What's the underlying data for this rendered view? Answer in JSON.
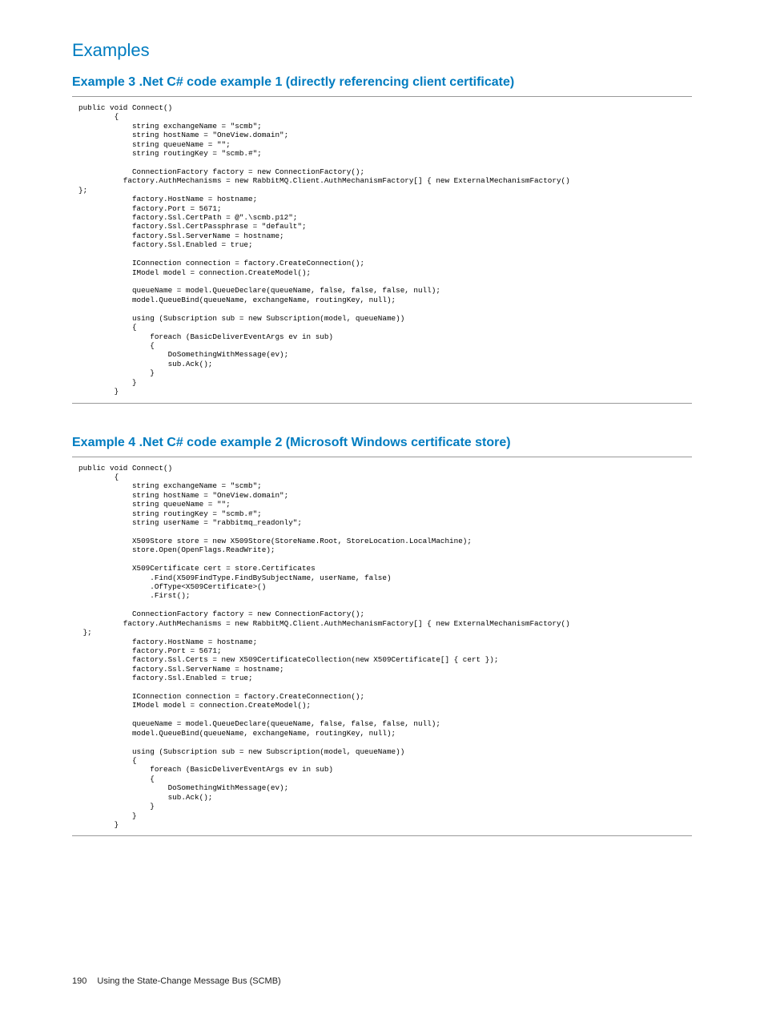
{
  "section": {
    "title": "Examples"
  },
  "example3": {
    "title": "Example 3 .Net C# code example 1 (directly referencing client certificate)",
    "code": "public void Connect()\n        {\n            string exchangeName = \"scmb\";\n            string hostName = \"OneView.domain\";\n            string queueName = \"\";\n            string routingKey = \"scmb.#\";\n\n            ConnectionFactory factory = new ConnectionFactory();\n          factory.AuthMechanisms = new RabbitMQ.Client.AuthMechanismFactory[] { new ExternalMechanismFactory()\n};\n            factory.HostName = hostname;\n            factory.Port = 5671;\n            factory.Ssl.CertPath = @\".\\scmb.p12\";\n            factory.Ssl.CertPassphrase = \"default\";\n            factory.Ssl.ServerName = hostname;\n            factory.Ssl.Enabled = true;\n\n            IConnection connection = factory.CreateConnection();\n            IModel model = connection.CreateModel();\n\n            queueName = model.QueueDeclare(queueName, false, false, false, null);\n            model.QueueBind(queueName, exchangeName, routingKey, null);\n\n            using (Subscription sub = new Subscription(model, queueName))\n            {\n                foreach (BasicDeliverEventArgs ev in sub)\n                {\n                    DoSomethingWithMessage(ev);\n                    sub.Ack();\n                }\n            }\n        }"
  },
  "example4": {
    "title": "Example 4 .Net C# code example 2 (Microsoft Windows certificate store)",
    "code": "public void Connect()\n        {\n            string exchangeName = \"scmb\";\n            string hostName = \"OneView.domain\";\n            string queueName = \"\";\n            string routingKey = \"scmb.#\";\n            string userName = \"rabbitmq_readonly\";\n\n            X509Store store = new X509Store(StoreName.Root, StoreLocation.LocalMachine);\n            store.Open(OpenFlags.ReadWrite);\n\n            X509Certificate cert = store.Certificates\n                .Find(X509FindType.FindBySubjectName, userName, false)\n                .OfType<X509Certificate>()\n                .First();\n\n            ConnectionFactory factory = new ConnectionFactory();\n          factory.AuthMechanisms = new RabbitMQ.Client.AuthMechanismFactory[] { new ExternalMechanismFactory()\n };\n            factory.HostName = hostname;\n            factory.Port = 5671;\n            factory.Ssl.Certs = new X509CertificateCollection(new X509Certificate[] { cert });\n            factory.Ssl.ServerName = hostname;\n            factory.Ssl.Enabled = true;\n\n            IConnection connection = factory.CreateConnection();\n            IModel model = connection.CreateModel();\n\n            queueName = model.QueueDeclare(queueName, false, false, false, null);\n            model.QueueBind(queueName, exchangeName, routingKey, null);\n\n            using (Subscription sub = new Subscription(model, queueName))\n            {\n                foreach (BasicDeliverEventArgs ev in sub)\n                {\n                    DoSomethingWithMessage(ev);\n                    sub.Ack();\n                }\n            }\n        }"
  },
  "footer": {
    "page_number": "190",
    "text": "Using the State-Change Message Bus (SCMB)"
  }
}
